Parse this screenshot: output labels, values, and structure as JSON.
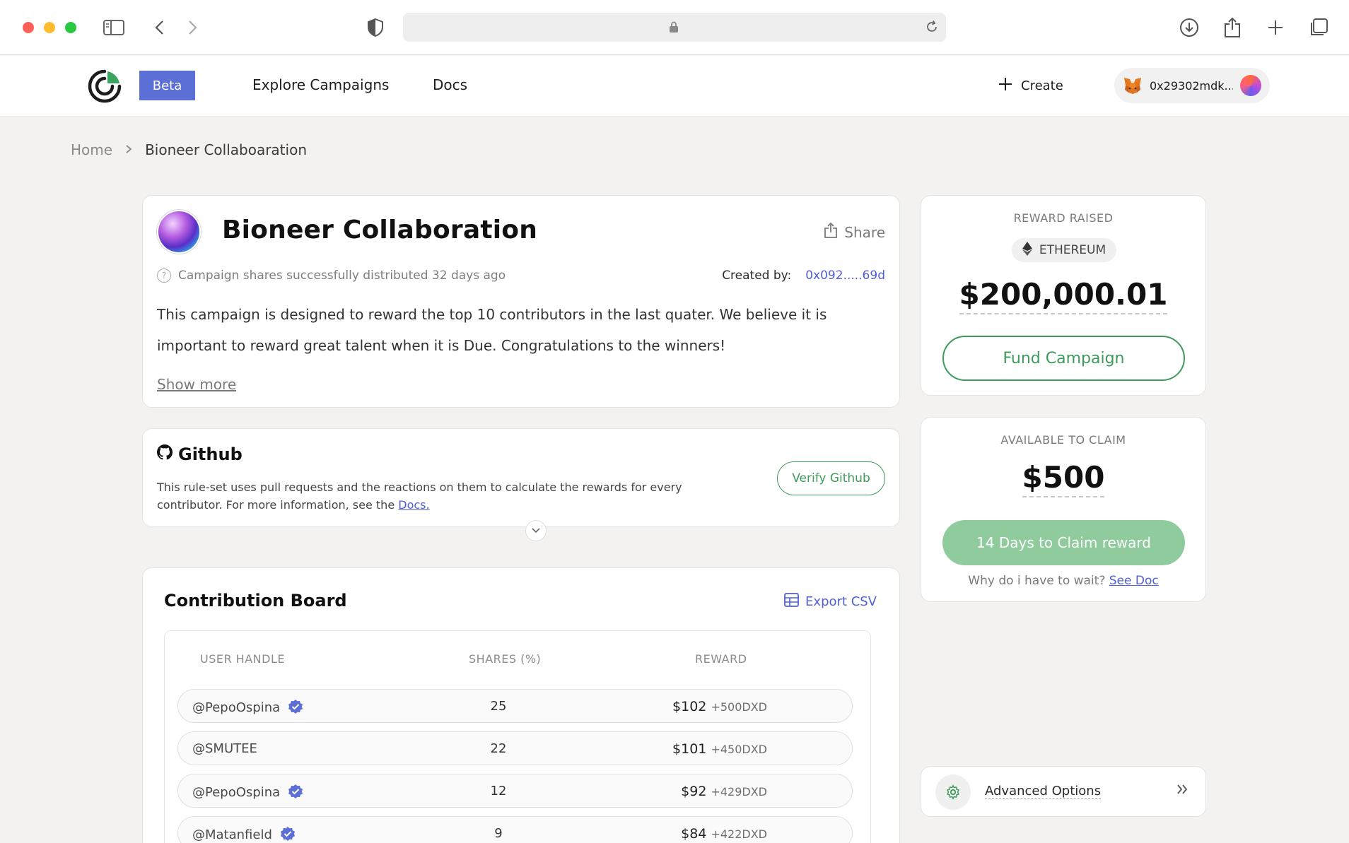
{
  "nav": {
    "beta_label": "Beta",
    "explore_label": "Explore Campaigns",
    "docs_label": "Docs",
    "create_label": "Create",
    "wallet_address": "0x29302mdk...."
  },
  "breadcrumb": {
    "home": "Home",
    "current": "Bioneer Collaboaration"
  },
  "campaign": {
    "title": "Bioneer Collaboration",
    "share_label": "Share",
    "status": "Campaign shares successfully distributed 32 days ago",
    "created_by_label": "Created by:",
    "created_by_address": "0x092.....69d",
    "description": "This  campaign is designed to reward the top 10 contributors in the last quater. We believe it is important to reward great talent when it is Due. Congratulations to the winners!",
    "show_more": "Show more"
  },
  "github": {
    "title": "Github",
    "description": "This rule-set uses pull requests and the reactions on them to calculate the rewards for every contributor. For more information, see the",
    "docs_link": "Docs.",
    "verify_label": "Verify Github"
  },
  "board": {
    "title": "Contribution Board",
    "export_label": "Export CSV",
    "columns": [
      "USER HANDLE",
      "SHARES (%)",
      "REWARD"
    ],
    "rows": [
      {
        "user": "@PepoOspina",
        "verified": true,
        "shares": "25",
        "reward": "$102",
        "dxd": "+500DXD"
      },
      {
        "user": "@SMUTEE",
        "verified": false,
        "shares": "22",
        "reward": "$101",
        "dxd": "+450DXD"
      },
      {
        "user": "@PepoOspina",
        "verified": true,
        "shares": "12",
        "reward": "$92",
        "dxd": "+429DXD"
      },
      {
        "user": "@Matanfield",
        "verified": true,
        "shares": "9",
        "reward": "$84",
        "dxd": "+422DXD"
      }
    ]
  },
  "reward_raised": {
    "label": "REWARD RAISED",
    "token": "ETHEREUM",
    "amount": "$200,000.01",
    "fund_label": "Fund Campaign"
  },
  "claim": {
    "label": "AVAILABLE TO CLAIM",
    "amount": "$500",
    "button_label": "14 Days to Claim reward",
    "wait_text": "Why do i have to wait?",
    "see_doc": "See Doc"
  },
  "advanced": {
    "label": "Advanced Options"
  },
  "colors": {
    "accent_blue": "#5b6fd6",
    "accent_green": "#3d9a5a",
    "claim_green": "#8fcb9c",
    "link_blue": "#4f5fd6"
  },
  "icons": [
    "sidebar-toggle-icon",
    "back-icon",
    "forward-icon",
    "shield-icon",
    "lock-icon",
    "reload-icon",
    "download-icon",
    "share-icon",
    "plus-icon",
    "tabs-icon",
    "metamask-fox-icon",
    "question-icon",
    "github-icon",
    "chevron-down-icon",
    "table-icon",
    "verified-badge-icon",
    "ethereum-icon",
    "gear-icon",
    "double-chevron-right-icon"
  ]
}
